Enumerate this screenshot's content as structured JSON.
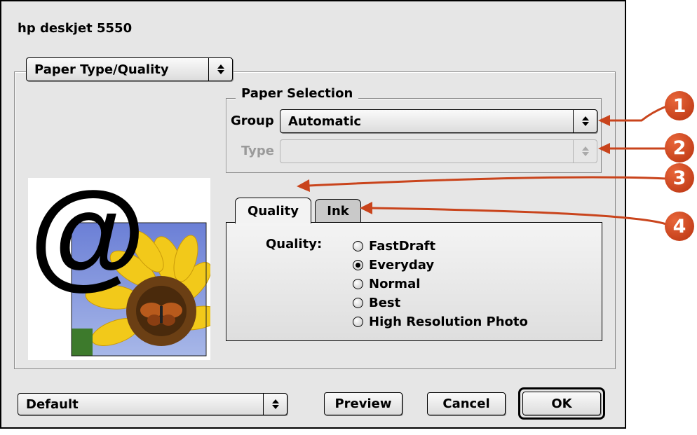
{
  "dialog": {
    "title": "hp deskjet 5550"
  },
  "panel_popup": {
    "label": "Paper Type/Quality"
  },
  "paper_selection": {
    "title": "Paper Selection",
    "group_label": "Group",
    "group_value": "Automatic",
    "type_label": "Type",
    "type_value": ""
  },
  "tabs": [
    {
      "label": "Quality",
      "active": true
    },
    {
      "label": "Ink",
      "active": false
    }
  ],
  "quality": {
    "label": "Quality:",
    "options": [
      "FastDraft",
      "Everyday",
      "Normal",
      "Best",
      "High Resolution Photo"
    ],
    "selected": "Everyday"
  },
  "footer": {
    "settings_popup": "Default",
    "preview_button": "Preview",
    "cancel_button": "Cancel",
    "ok_button": "OK"
  },
  "callouts": [
    "1",
    "2",
    "3",
    "4"
  ],
  "preview_image": {
    "glyph": "@"
  },
  "colors": {
    "callout": "#c9441c",
    "dialog_bg": "#e6e6e6",
    "disabled_text": "#9a9a9a"
  }
}
